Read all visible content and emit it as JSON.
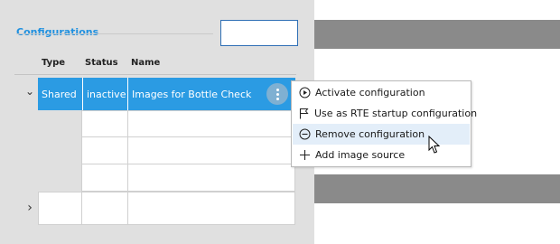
{
  "configurations": {
    "title": "Configurations",
    "search_value": "",
    "columns": {
      "type": "Type",
      "status": "Status",
      "name": "Name"
    },
    "rows": [
      {
        "type": "Shared",
        "status": "inactive",
        "name": "Images for Bottle Check",
        "expanded": true,
        "selected": true
      }
    ],
    "expander_expanded": "⌄",
    "expander_collapsed": "›"
  },
  "context_menu": {
    "items": [
      {
        "label": "Activate configuration",
        "icon": "play-circle-icon"
      },
      {
        "label": "Use as RTE startup configuration",
        "icon": "flag-icon"
      },
      {
        "label": "Remove configuration",
        "icon": "minus-circle-icon",
        "hovered": true
      },
      {
        "label": "Add image source",
        "icon": "plus-icon"
      }
    ]
  },
  "colors": {
    "accent": "#1e90e0",
    "selection": "#2b9be3",
    "menu_hover": "#e3eef9",
    "band": "#8a8a8a"
  }
}
